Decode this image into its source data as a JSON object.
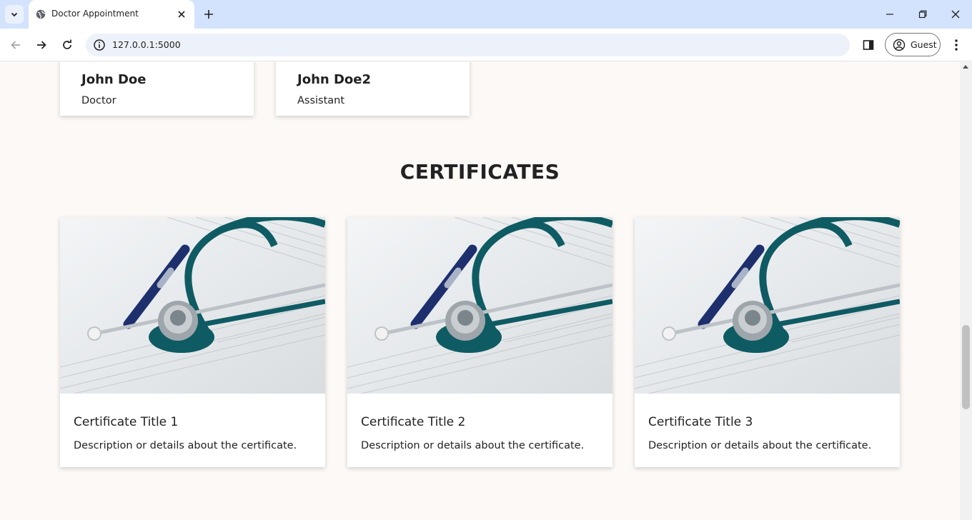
{
  "browser": {
    "tab_title": "Doctor Appointment",
    "url": "127.0.0.1:5000",
    "profile_label": "Guest"
  },
  "staff": [
    {
      "name": "John Doe",
      "role": "Doctor"
    },
    {
      "name": "John Doe2",
      "role": "Assistant"
    }
  ],
  "certificates_section": {
    "heading": "CERTIFICATES",
    "items": [
      {
        "title": "Certificate Title 1",
        "description": "Description or details about the certificate."
      },
      {
        "title": "Certificate Title 2",
        "description": "Description or details about the certificate."
      },
      {
        "title": "Certificate Title 3",
        "description": "Description or details about the certificate."
      }
    ]
  },
  "colors": {
    "tabbar_bg": "#d3e3fd",
    "omnibox_bg": "#edf2fa",
    "page_bg": "#fdf9f7",
    "stethoscope_teal": "#0f5b63"
  }
}
